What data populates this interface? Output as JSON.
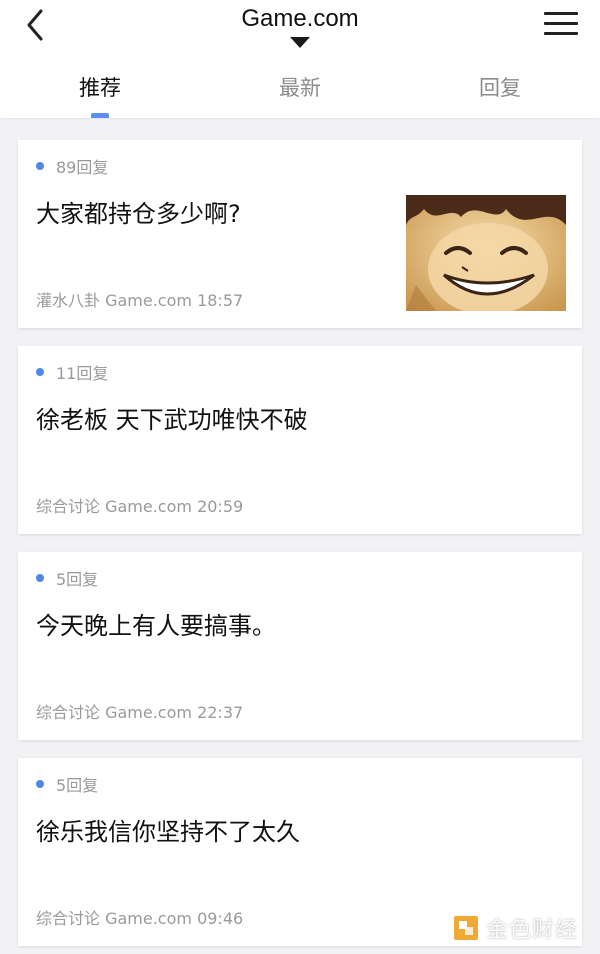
{
  "header": {
    "back_icon": "chevron-left-icon",
    "title": "Game.com",
    "title_dropdown_icon": "caret-down-icon",
    "menu_icon": "hamburger-menu-icon"
  },
  "tabs": [
    {
      "label": "推荐",
      "active": true
    },
    {
      "label": "最新",
      "active": false
    },
    {
      "label": "回复",
      "active": false
    }
  ],
  "posts": [
    {
      "replies": "89回复",
      "title": "大家都持仓多少啊?",
      "meta": "灌水八卦 Game.com 18:57",
      "has_thumbnail": true
    },
    {
      "replies": "11回复",
      "title": "徐老板 天下武功唯快不破",
      "meta": "综合讨论 Game.com 20:59",
      "has_thumbnail": false
    },
    {
      "replies": "5回复",
      "title": "今天晚上有人要搞事。",
      "meta": "综合讨论 Game.com 22:37",
      "has_thumbnail": false
    },
    {
      "replies": "5回复",
      "title": "徐乐我信你坚持不了太久",
      "meta": "综合讨论 Game.com 09:46",
      "has_thumbnail": false
    }
  ],
  "watermark": {
    "text": "金色财经",
    "logo_icon": "jinse-logo-icon"
  },
  "colors": {
    "accent": "#5a8ef0",
    "reply_dot": "#4f87e8",
    "background": "#f2f2f4",
    "meta_text": "#9a9a9a"
  }
}
